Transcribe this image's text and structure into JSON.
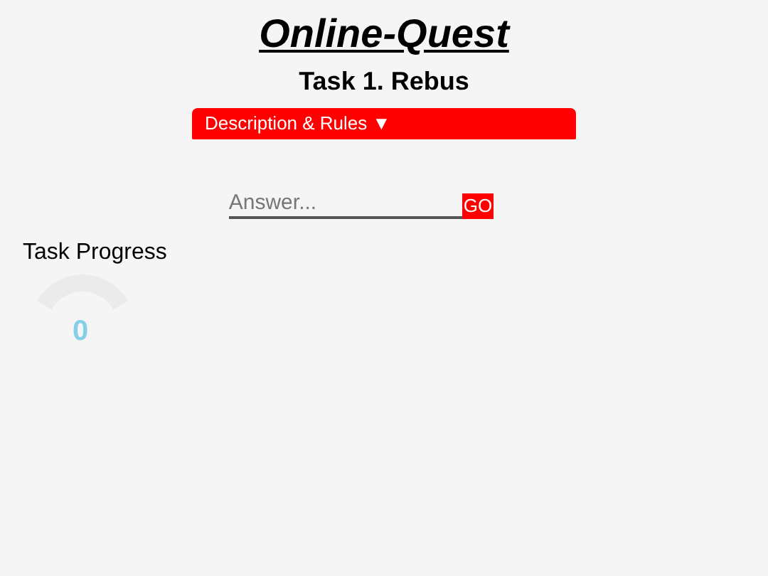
{
  "title": "Online-Quest",
  "task_title": "Task 1. Rebus",
  "description_toggle": {
    "label": "Description & Rules ▼",
    "expanded": false
  },
  "answer": {
    "placeholder": "Answer...",
    "button": "GO"
  },
  "progress": {
    "label": "Task Progress",
    "level": 0,
    "value": "0"
  }
}
